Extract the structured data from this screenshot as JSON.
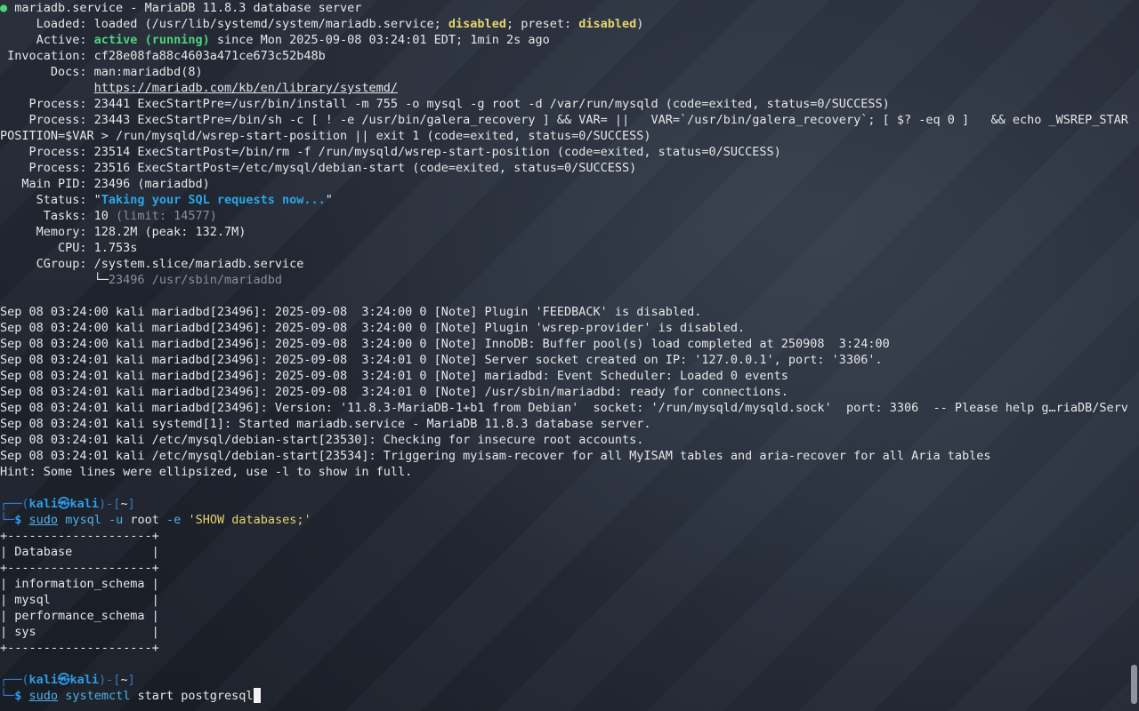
{
  "terminal": {
    "status": {
      "bullet": "●",
      "header": " mariadb.service - MariaDB 11.8.3 database server",
      "loaded_a": "     Loaded: loaded (/usr/lib/systemd/system/mariadb.service; ",
      "loaded_disabled": "disabled",
      "loaded_b": "; preset: ",
      "loaded_preset": "disabled",
      "loaded_c": ")",
      "active_a": "     Active: ",
      "active_state": "active (running)",
      "active_b": " since Mon 2025-09-08 03:24:01 EDT; 1min 2s ago",
      "invocation": " Invocation: cf28e08fa88c4603a471ce673c52b48b",
      "docs_a": "       Docs: man:mariadbd(8)",
      "docs_pad": "             ",
      "docs_url": "https://mariadb.com/kb/en/library/systemd/",
      "process1": "    Process: 23441 ExecStartPre=/usr/bin/install -m 755 -o mysql -g root -d /var/run/mysqld (code=exited, status=0/SUCCESS)",
      "process2": "    Process: 23443 ExecStartPre=/bin/sh -c [ ! -e /usr/bin/galera_recovery ] && VAR= ||   VAR=`/usr/bin/galera_recovery`; [ $? -eq 0 ]   && echo _WSREP_START_",
      "process2_wrap": "POSITION=$VAR > /run/mysqld/wsrep-start-position || exit 1 (code=exited, status=0/SUCCESS)",
      "process3": "    Process: 23514 ExecStartPost=/bin/rm -f /run/mysqld/wsrep-start-position (code=exited, status=0/SUCCESS)",
      "process4": "    Process: 23516 ExecStartPost=/etc/mysql/debian-start (code=exited, status=0/SUCCESS)",
      "mainpid": "   Main PID: 23496 (mariadbd)",
      "status_a": "     Status: \"",
      "status_msg": "Taking your SQL requests now...",
      "status_b": "\"",
      "tasks_a": "      Tasks: 10 ",
      "tasks_limit": "(limit: 14577)",
      "memory": "     Memory: 128.2M (peak: 132.7M)",
      "cpu": "        CPU: 1.753s",
      "cgroup": "     CGroup: /system.slice/mariadb.service",
      "cgroup_child_pad": "             └─",
      "cgroup_child": "23496 /usr/sbin/mariadbd"
    },
    "log_lines": [
      "Sep 08 03:24:00 kali mariadbd[23496]: 2025-09-08  3:24:00 0 [Note] Plugin 'FEEDBACK' is disabled.",
      "Sep 08 03:24:00 kali mariadbd[23496]: 2025-09-08  3:24:00 0 [Note] Plugin 'wsrep-provider' is disabled.",
      "Sep 08 03:24:00 kali mariadbd[23496]: 2025-09-08  3:24:00 0 [Note] InnoDB: Buffer pool(s) load completed at 250908  3:24:00",
      "Sep 08 03:24:01 kali mariadbd[23496]: 2025-09-08  3:24:01 0 [Note] Server socket created on IP: '127.0.0.1', port: '3306'.",
      "Sep 08 03:24:01 kali mariadbd[23496]: 2025-09-08  3:24:01 0 [Note] mariadbd: Event Scheduler: Loaded 0 events",
      "Sep 08 03:24:01 kali mariadbd[23496]: 2025-09-08  3:24:01 0 [Note] /usr/sbin/mariadbd: ready for connections.",
      "Sep 08 03:24:01 kali mariadbd[23496]: Version: '11.8.3-MariaDB-1+b1 from Debian'  socket: '/run/mysqld/mysqld.sock'  port: 3306  -- Please help g…riaDB/Server",
      "Sep 08 03:24:01 kali systemd[1]: Started mariadb.service - MariaDB 11.8.3 database server.",
      "Sep 08 03:24:01 kali /etc/mysql/debian-start[23530]: Checking for insecure root accounts.",
      "Sep 08 03:24:01 kali /etc/mysql/debian-start[23534]: Triggering myisam-recover for all MyISAM tables and aria-recover for all Aria tables"
    ],
    "hint": "Hint: Some lines were ellipsized, use -l to show in full.",
    "prompt": {
      "frame_top_left": "┌──(",
      "user": "kali㉿kali",
      "frame_mid": ")-[",
      "cwd": "~",
      "frame_end": "]",
      "frame_bottom": "└─",
      "dollar": "$ "
    },
    "command1": {
      "sudo": "sudo",
      "name": "mysql",
      "flag_u": "-u",
      "user": "root",
      "flag_e": "-e",
      "query": "'SHOW databases;'"
    },
    "db_table": {
      "border": "+--------------------+",
      "header": "| Database           |",
      "rows": [
        "| information_schema |",
        "| mysql              |",
        "| performance_schema |",
        "| sys                |"
      ]
    },
    "command2": {
      "sudo": "sudo",
      "name": "systemctl",
      "args": "start postgresql"
    }
  },
  "colors": {
    "active": "#4fd37a",
    "warning": "#e5d36b",
    "accent": "#2aa6e6",
    "prompt": "#2f9be8"
  }
}
